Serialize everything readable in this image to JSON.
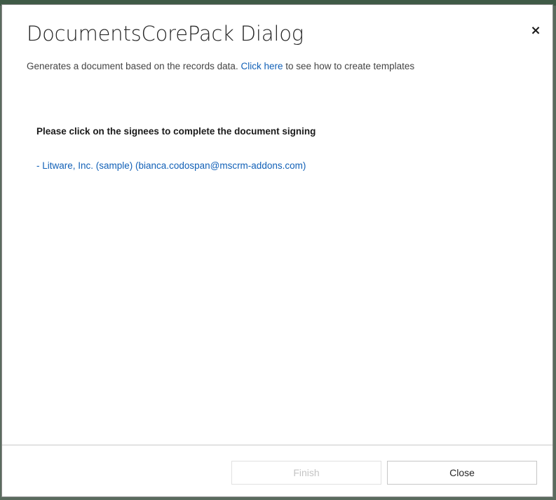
{
  "dialog": {
    "title": "DocumentsCorePack Dialog",
    "close_icon": "×",
    "subtitle_prefix": "Generates a document based on the records data. ",
    "subtitle_link": "Click here",
    "subtitle_suffix": " to see how to create templates"
  },
  "content": {
    "instruction": "Please click on the signees to complete the document signing",
    "signees": [
      "- Litware, Inc. (sample) (bianca.codospan@mscrm-addons.com)"
    ]
  },
  "footer": {
    "finish_label": "Finish",
    "finish_enabled": false,
    "close_label": "Close"
  },
  "colors": {
    "link": "#1160b7",
    "title": "#262626",
    "disabled_text": "#c4c4c4"
  }
}
